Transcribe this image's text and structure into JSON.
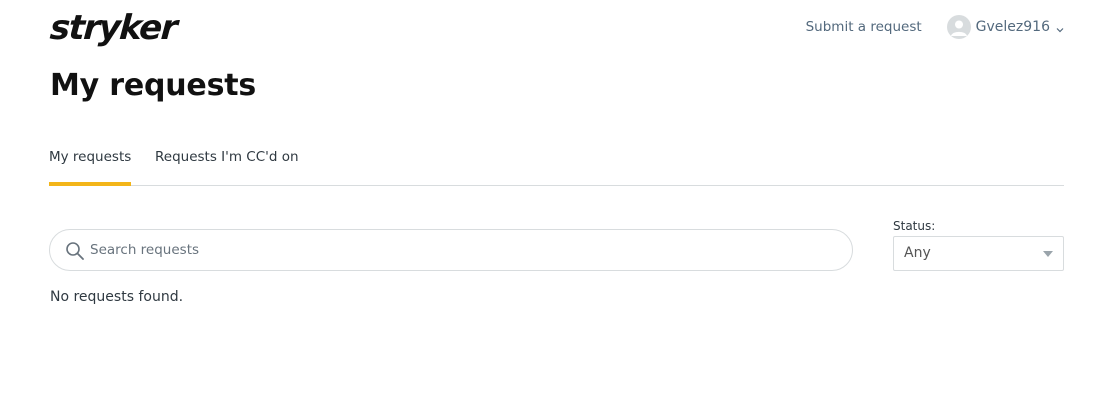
{
  "header": {
    "logo_text": "stryker",
    "submit_request_label": "Submit a request",
    "user_name": "Gvelez916",
    "icons": {
      "avatar": "user-avatar-icon",
      "chevron": "chevron-down-icon"
    }
  },
  "page": {
    "title": "My requests"
  },
  "tabs": [
    {
      "label": "My requests",
      "active": true
    },
    {
      "label": "Requests I'm CC'd on",
      "active": false
    }
  ],
  "search": {
    "placeholder": "Search requests",
    "value": "",
    "icon": "search-icon"
  },
  "status_filter": {
    "label": "Status:",
    "selected": "Any"
  },
  "results": {
    "empty_message": "No requests found."
  },
  "colors": {
    "accent": "#f3b519",
    "link": "#53697d",
    "border": "#d8dcde"
  }
}
